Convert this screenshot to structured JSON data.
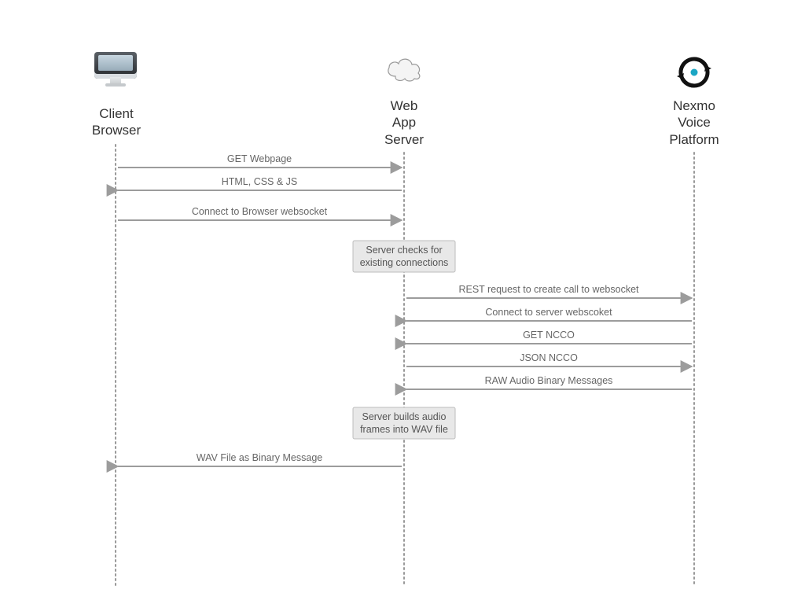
{
  "participants": {
    "client": {
      "label_line1": "Client",
      "label_line2": "Browser"
    },
    "server": {
      "label_line1": "Web",
      "label_line2": "App",
      "label_line3": "Server"
    },
    "nexmo": {
      "label_line1": "Nexmo",
      "label_line2": "Voice",
      "label_line3": "Platform"
    }
  },
  "messages": {
    "m1": "GET Webpage",
    "m2": "HTML, CSS & JS",
    "m3": "Connect to Browser websocket",
    "m4": "REST request to create call to websocket",
    "m5": "Connect to server webscoket",
    "m6": "GET NCCO",
    "m7": "JSON NCCO",
    "m8": "RAW Audio Binary Messages",
    "m9": "WAV File as Binary Message"
  },
  "notes": {
    "n1_line1": "Server checks for",
    "n1_line2": "existing connections",
    "n2_line1": "Server builds audio",
    "n2_line2": "frames into WAV file"
  },
  "colors": {
    "arrow": "#9c9c9c",
    "text": "#666",
    "nexmo_teal": "#1ba6c4"
  }
}
